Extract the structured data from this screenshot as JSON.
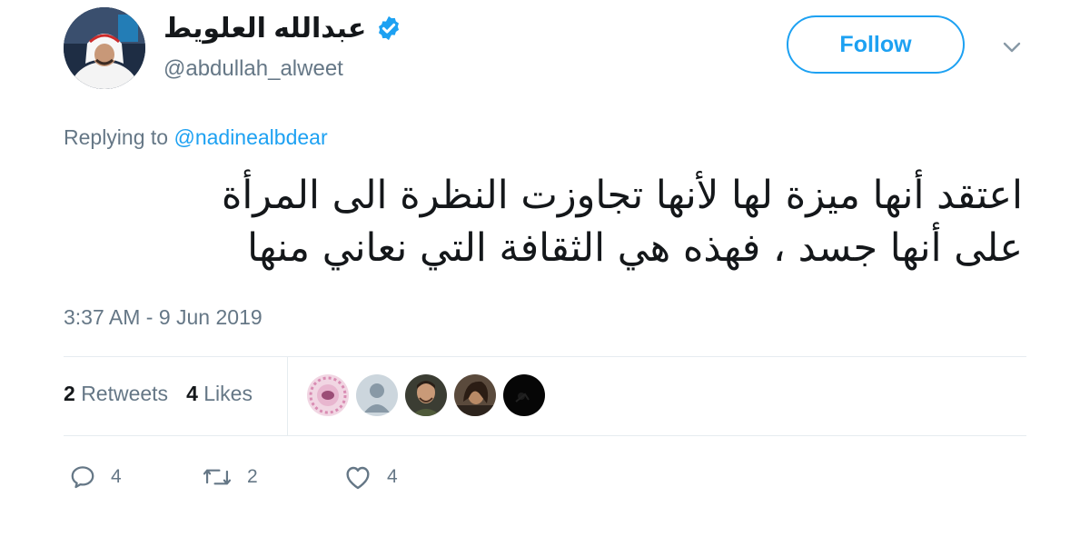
{
  "author": {
    "display_name": "عبدالله العلويط",
    "handle": "@abdullah_alweet",
    "verified": true
  },
  "header": {
    "follow_label": "Follow"
  },
  "reply": {
    "prefix": "Replying to ",
    "mention": "@nadinealbdear"
  },
  "tweet": {
    "text_line1": "اعتقد أنها ميزة لها لأنها تجاوزت النظرة الى المرأة",
    "text_line2": "على أنها جسد ، فهذه هي الثقافة التي نعاني منها",
    "timestamp": "3:37 AM - 9 Jun 2019"
  },
  "stats": {
    "retweets_count": "2",
    "retweets_label": "Retweets",
    "likes_count": "4",
    "likes_label": "Likes"
  },
  "actions": {
    "reply_count": "4",
    "retweet_count": "2",
    "like_count": "4"
  },
  "colors": {
    "accent": "#1da1f2",
    "secondary_text": "#657786",
    "primary_text": "#14171a",
    "divider": "#e6ecf0"
  },
  "icons": [
    "verified-badge-icon",
    "chevron-down-icon",
    "reply-icon",
    "retweet-icon",
    "like-icon"
  ]
}
